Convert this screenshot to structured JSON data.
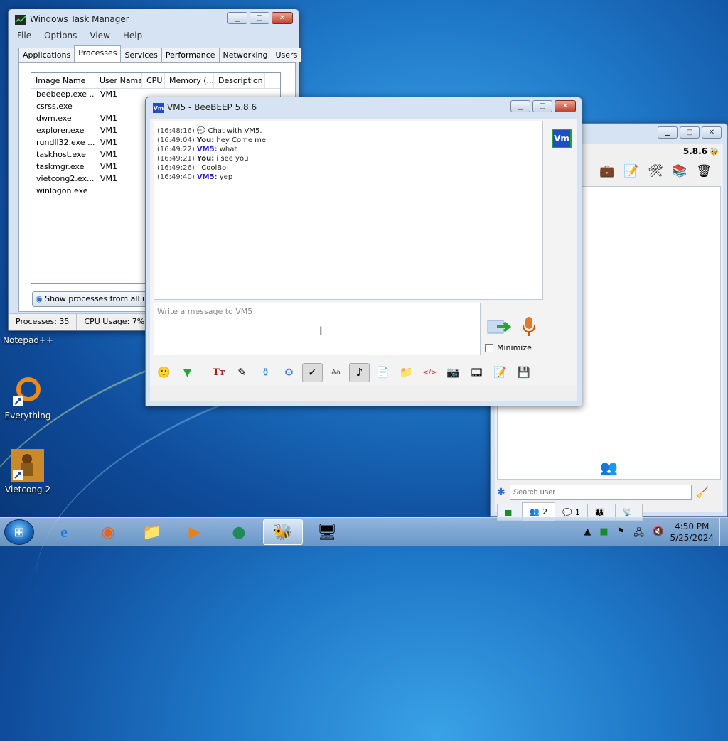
{
  "desktop": {
    "icons": [
      {
        "label": "Notepad++"
      },
      {
        "label": "Everything"
      },
      {
        "label": "Vietcong 2"
      }
    ]
  },
  "task_manager": {
    "title": "Windows Task Manager",
    "menu": [
      "File",
      "Options",
      "View",
      "Help"
    ],
    "tabs": [
      "Applications",
      "Processes",
      "Services",
      "Performance",
      "Networking",
      "Users"
    ],
    "active_tab": "Processes",
    "columns": [
      "Image Name",
      "User Name",
      "CPU",
      "Memory (...",
      "Description"
    ],
    "rows": [
      {
        "image": "beebeep.exe ...",
        "user": "VM1"
      },
      {
        "image": "csrss.exe",
        "user": ""
      },
      {
        "image": "dwm.exe",
        "user": "VM1"
      },
      {
        "image": "explorer.exe",
        "user": "VM1"
      },
      {
        "image": "rundll32.exe ...",
        "user": "VM1"
      },
      {
        "image": "taskhost.exe",
        "user": "VM1"
      },
      {
        "image": "taskmgr.exe",
        "user": "VM1"
      },
      {
        "image": "vietcong2.ex...",
        "user": "VM1"
      },
      {
        "image": "winlogon.exe",
        "user": ""
      }
    ],
    "show_all_button": "Show processes from all users",
    "status": {
      "processes": "Processes: 35",
      "cpu": "CPU Usage: 7%"
    }
  },
  "chat_window": {
    "title": "VM5 - BeeBEEP 5.8.6",
    "avatar_text": "Vm",
    "messages": [
      {
        "time": "(16:48:16)",
        "sender": "",
        "text": "Chat with VM5."
      },
      {
        "time": "(16:49:04)",
        "sender": "You:",
        "text": "hey Come me"
      },
      {
        "time": "(16:49:22)",
        "sender": "VM5:",
        "text": "what"
      },
      {
        "time": "(16:49:21)",
        "sender": "You:",
        "text": "i see you"
      },
      {
        "time": "(16:49:26)",
        "sender": "",
        "text": "CoolBoi"
      },
      {
        "time": "(16:49:40)",
        "sender": "VM5:",
        "text": "yep"
      }
    ],
    "message_placeholder": "Write a message to VM5",
    "minimize_label": "Minimize",
    "toolbar_icons": [
      "smiley-icon",
      "download-icon",
      "font-icon",
      "color-icon",
      "filter-icon",
      "settings-icon",
      "spellcheck-icon",
      "text-icon",
      "music-icon",
      "send-file-icon",
      "send-folder-icon",
      "code-icon",
      "screenshot-icon",
      "film-icon",
      "edit-icon",
      "save-icon"
    ]
  },
  "main_window": {
    "version": "5.8.6",
    "search_placeholder": "Search user",
    "tabs": [
      {
        "icon": "status-icon",
        "label": ""
      },
      {
        "icon": "users-icon",
        "label": "2"
      },
      {
        "icon": "chats-icon",
        "label": "1"
      },
      {
        "icon": "groups-icon",
        "label": ""
      },
      {
        "icon": "shares-icon",
        "label": ""
      }
    ]
  },
  "taskbar": {
    "clock_time": "4:50 PM",
    "clock_date": "5/25/2024"
  },
  "colors": {
    "accent": "#1d4fbf",
    "vm_name": "#2525c8",
    "close_red": "#c3412a"
  }
}
